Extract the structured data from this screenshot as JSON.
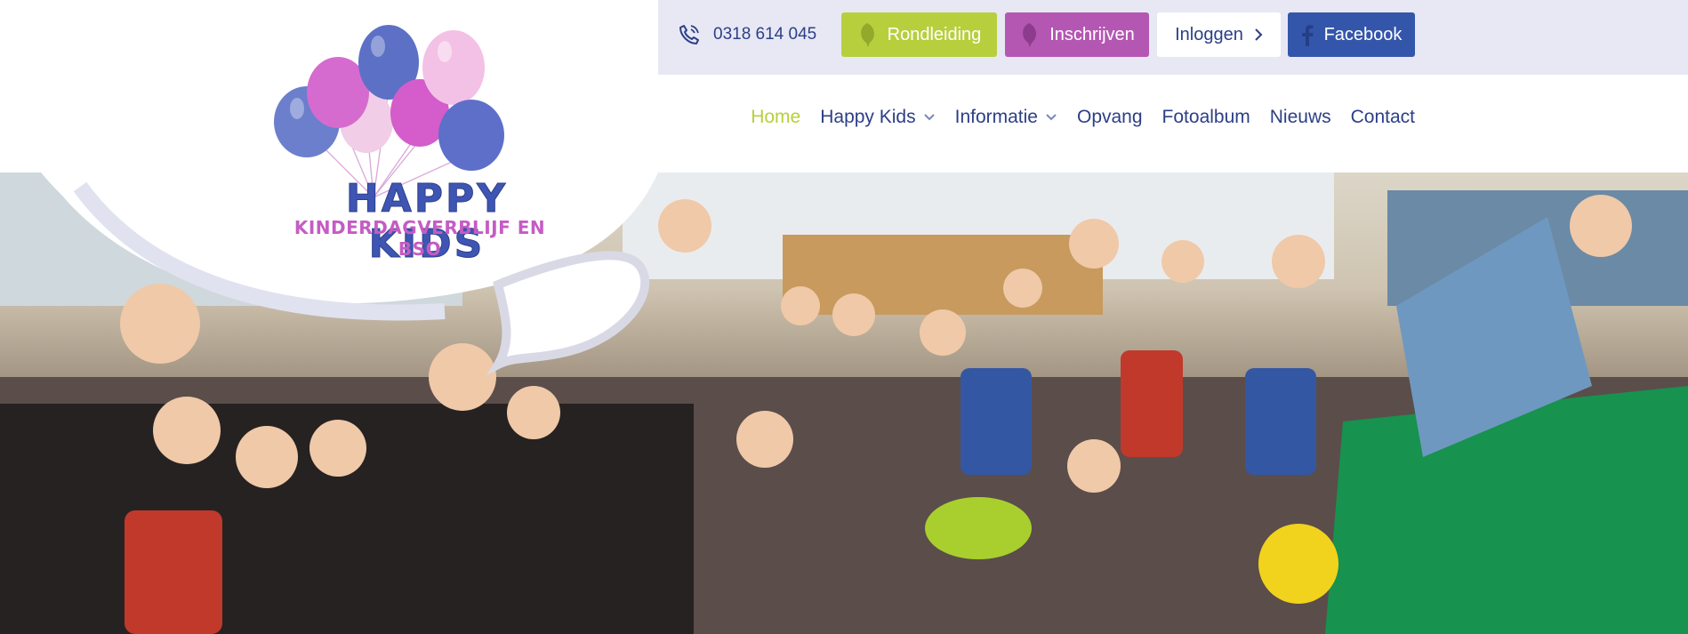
{
  "header": {
    "phone": "0318 614 045",
    "buttons": {
      "tour": "Rondleiding",
      "enroll": "Inschrijven",
      "login": "Inloggen",
      "facebook": "Facebook"
    }
  },
  "logo": {
    "title": "HAPPY KIDS",
    "subtitle": "KINDERDAGVERBLIJF EN BSO"
  },
  "nav": {
    "items": [
      {
        "label": "Home",
        "active": true
      },
      {
        "label": "Happy Kids",
        "has_dropdown": true
      },
      {
        "label": "Informatie",
        "has_dropdown": true
      },
      {
        "label": "Opvang"
      },
      {
        "label": "Fotoalbum"
      },
      {
        "label": "Nieuws"
      },
      {
        "label": "Contact"
      }
    ]
  },
  "colors": {
    "navy": "#2c3f87",
    "green": "#b8cf3d",
    "pink": "#b457b3",
    "facebook_blue": "#3456aa",
    "top_strip": "#e7e8f4"
  },
  "icons": {
    "phone": "phone-icon",
    "tour": "leaf-icon",
    "enroll": "leaf-icon",
    "login": "chevron-right-icon",
    "facebook": "facebook-icon",
    "dropdown": "chevron-down-icon"
  }
}
